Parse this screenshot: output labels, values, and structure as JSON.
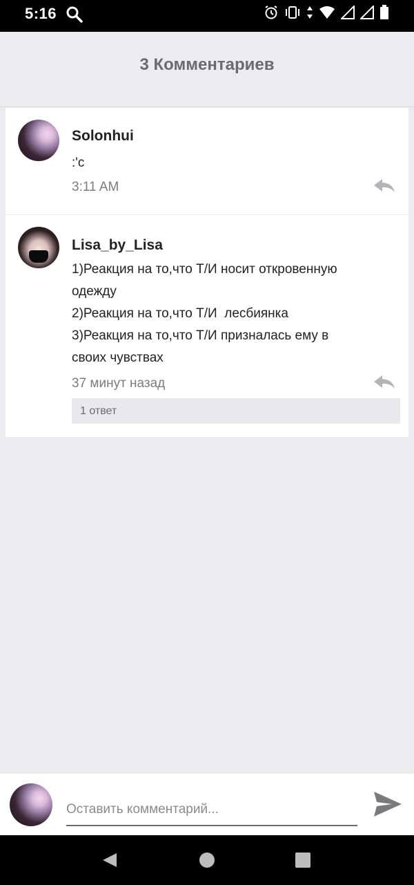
{
  "status_bar": {
    "time": "5:16",
    "icons": [
      "search-icon",
      "alarm-icon",
      "vibrate-icon",
      "data-arrows-icon",
      "wifi-icon",
      "signal-icon",
      "signal-icon",
      "battery-icon"
    ]
  },
  "header": {
    "title": "3 Комментариев"
  },
  "comments": [
    {
      "username": "Solonhui",
      "text_lines": [
        ":'c"
      ],
      "time": "3:11 AM"
    },
    {
      "username": "Lisa_by_Lisa",
      "text_lines": [
        "1)Реакция на то,что Т/И носит откровенную",
        "одежду",
        "2)Реакция на то,что Т/И  лесбиянка",
        "3)Реакция на то,что Т/И призналась ему в",
        "своих чувствах"
      ],
      "time": "37 минут назад",
      "replies_label": "1 ответ"
    }
  ],
  "composer": {
    "placeholder": "Оставить комментарий..."
  },
  "colors": {
    "background": "#ececee",
    "card": "#ffffff",
    "title": "#6b6b6e",
    "muted": "#7c7c80"
  }
}
